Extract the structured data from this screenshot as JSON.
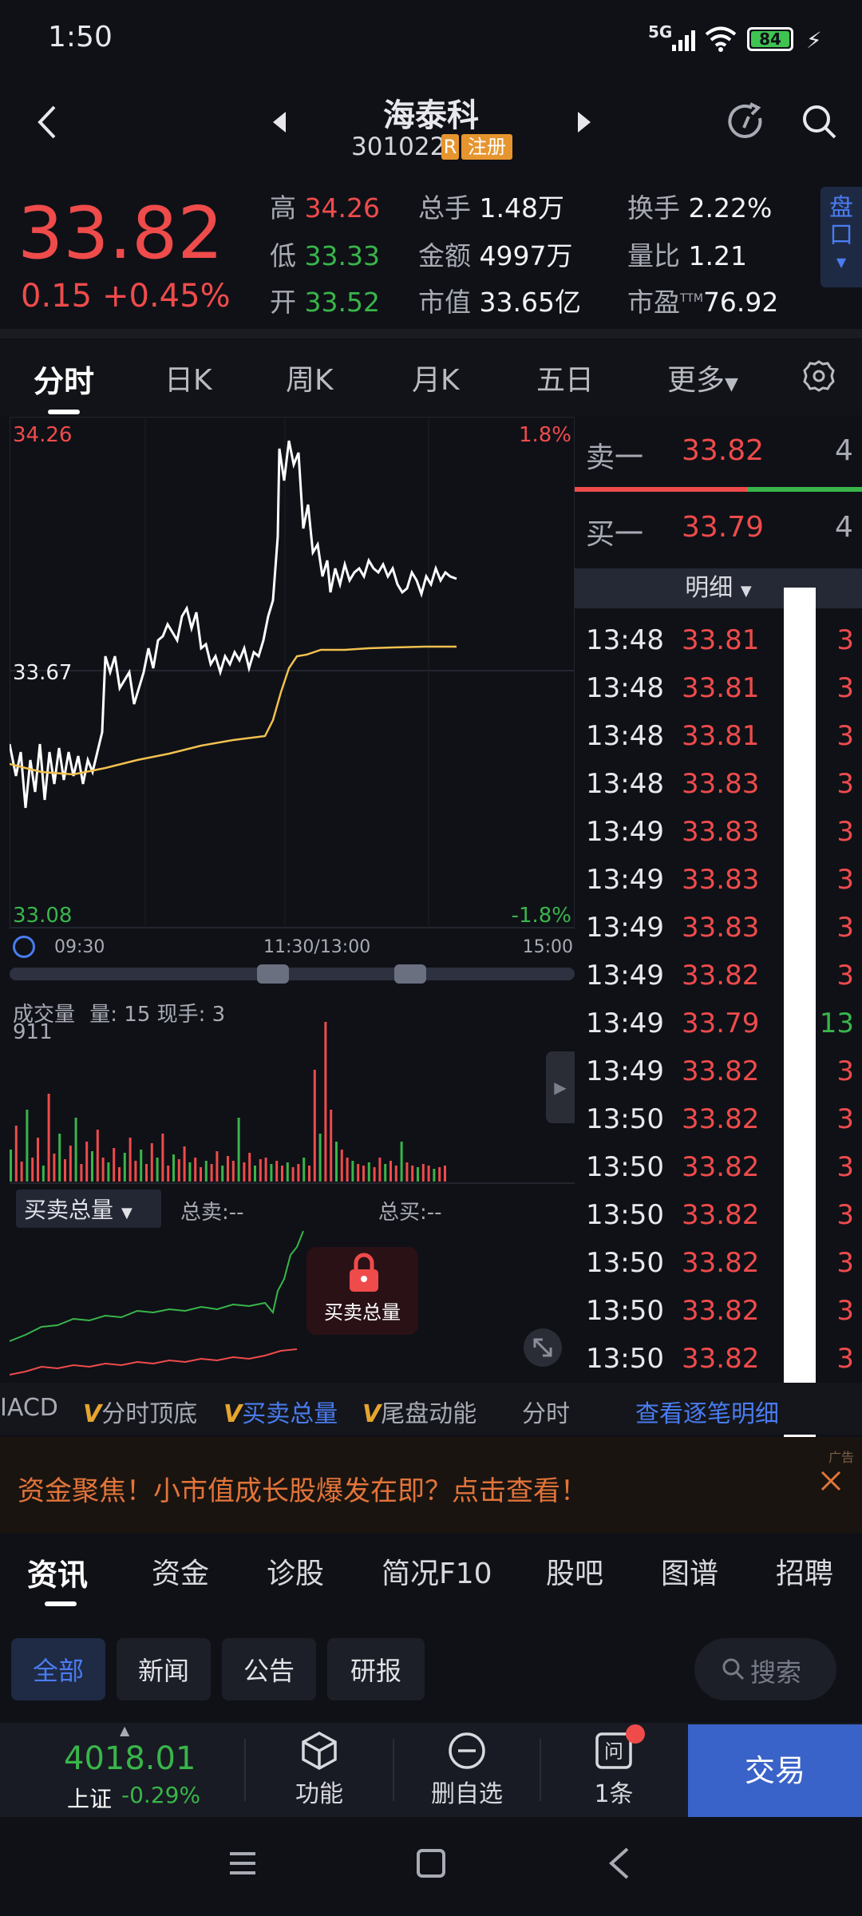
{
  "status_bar": {
    "time": "1:50",
    "network": "5G",
    "battery": "84"
  },
  "header": {
    "name": "海泰科",
    "code": "301022",
    "badge_r": "R",
    "badge_reg": "注册"
  },
  "quote": {
    "price": "33.82",
    "change": "0.15",
    "change_pct": "+0.45%",
    "high_label": "高",
    "high": "34.26",
    "low_label": "低",
    "low": "33.33",
    "open_label": "开",
    "open": "33.52",
    "vol_label": "总手",
    "vol": "1.48万",
    "amount_label": "金额",
    "amount": "4997万",
    "mcap_label": "市值",
    "mcap": "33.65亿",
    "turnover_label": "换手",
    "turnover": "2.22%",
    "vol_ratio_label": "量比",
    "vol_ratio": "1.21",
    "pe_label": "市盈",
    "pe_sup": "TTM",
    "pe": "76.92",
    "side_tab": "盘口"
  },
  "chart_tabs": [
    "分时",
    "日K",
    "周K",
    "月K",
    "五日",
    "更多"
  ],
  "chart": {
    "y_high": "34.26",
    "y_mid": "33.67",
    "y_low": "33.08",
    "pct_high": "1.8%",
    "pct_low": "-1.8%",
    "t_start": "09:30",
    "t_mid": "11:30/13:00",
    "t_end": "15:00",
    "vol_title": "成交量",
    "vol_info": "量: 15  现手: 3",
    "vol_max": "911",
    "bs_dropdown": "买卖总量",
    "total_sell": "总卖:--",
    "total_buy": "总买:--",
    "lock_label": "买卖总量"
  },
  "depth": {
    "sell1_label": "卖一",
    "sell1_price": "33.82",
    "sell1_qty": "4",
    "buy1_label": "买一",
    "buy1_price": "33.79",
    "buy1_qty": "4",
    "detail_label": "明细",
    "trades": [
      {
        "time": "13:48",
        "price": "33.81",
        "qty": "3",
        "side": "buy"
      },
      {
        "time": "13:48",
        "price": "33.81",
        "qty": "3",
        "side": "buy"
      },
      {
        "time": "13:48",
        "price": "33.81",
        "qty": "3",
        "side": "buy"
      },
      {
        "time": "13:48",
        "price": "33.83",
        "qty": "3",
        "side": "buy"
      },
      {
        "time": "13:49",
        "price": "33.83",
        "qty": "3",
        "side": "buy"
      },
      {
        "time": "13:49",
        "price": "33.83",
        "qty": "3",
        "side": "buy"
      },
      {
        "time": "13:49",
        "price": "33.83",
        "qty": "3",
        "side": "buy"
      },
      {
        "time": "13:49",
        "price": "33.82",
        "qty": "3",
        "side": "buy"
      },
      {
        "time": "13:49",
        "price": "33.79",
        "qty": "13",
        "side": "sell"
      },
      {
        "time": "13:49",
        "price": "33.82",
        "qty": "3",
        "side": "buy"
      },
      {
        "time": "13:50",
        "price": "33.82",
        "qty": "3",
        "side": "buy"
      },
      {
        "time": "13:50",
        "price": "33.82",
        "qty": "3",
        "side": "buy"
      },
      {
        "time": "13:50",
        "price": "33.82",
        "qty": "3",
        "side": "buy"
      },
      {
        "time": "13:50",
        "price": "33.82",
        "qty": "3",
        "side": "buy"
      },
      {
        "time": "13:50",
        "price": "33.82",
        "qty": "3",
        "side": "buy"
      },
      {
        "time": "13:50",
        "price": "33.82",
        "qty": "3",
        "side": "buy"
      }
    ]
  },
  "indicators": {
    "macd": "IACD",
    "v1": "分时顶底",
    "v2": "买卖总量",
    "v3": "尾盘动能",
    "plain": "分时",
    "link": "查看逐笔明细"
  },
  "ad": {
    "text": "资金聚焦！小市值成长股爆发在即？点击查看！",
    "tag": "广告"
  },
  "news_tabs": [
    "资讯",
    "资金",
    "诊股",
    "简况F10",
    "股吧",
    "图谱",
    "招聘"
  ],
  "filters": [
    "全部",
    "新闻",
    "公告",
    "研报"
  ],
  "search_placeholder": "搜索",
  "bottom": {
    "index_value": "4018.01",
    "index_name": "上证",
    "index_pct": "-0.29%",
    "func_label": "功能",
    "remove_label": "删自选",
    "ask_label": "1条",
    "trade_label": "交易"
  },
  "colors": {
    "up": "#ef4b4b",
    "down": "#39b54a",
    "avg_line": "#f2c14e",
    "accent": "#3a63c9"
  }
}
